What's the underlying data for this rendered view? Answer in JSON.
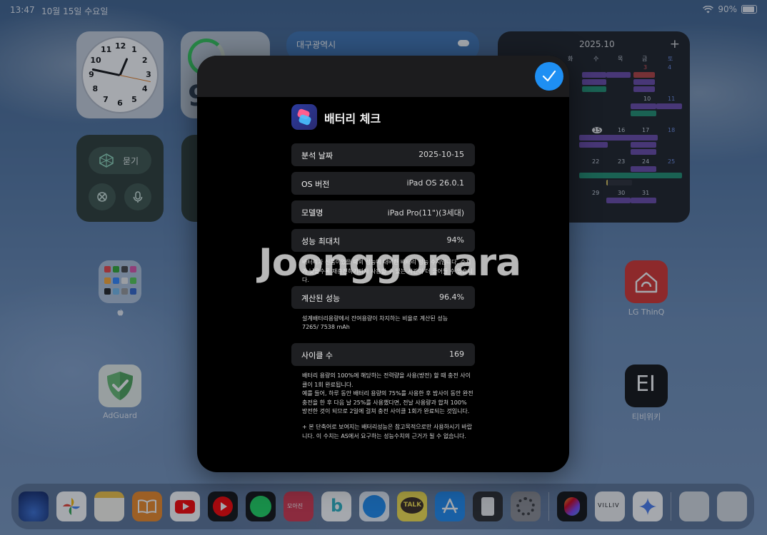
{
  "status_bar": {
    "time": "13:47",
    "date": "10월 15일 수요일",
    "battery_percent": "90%"
  },
  "widgets": {
    "clock_numbers": [
      "12",
      "1",
      "2",
      "3",
      "4",
      "5",
      "6",
      "7",
      "8",
      "9",
      "10",
      "11"
    ],
    "battery_value": "9",
    "weather_city": "대구광역시",
    "calendar": {
      "title": "2025.10",
      "weekday_headers": [
        "화",
        "수",
        "목",
        "금",
        "토"
      ],
      "dates": [
        "3",
        "4",
        "10",
        "11",
        "15",
        "16",
        "17",
        "18",
        "22",
        "23",
        "24",
        "25",
        "29",
        "30",
        "31"
      ]
    },
    "ask_label": "묻기"
  },
  "home_apps": [
    {
      "name": "LG ThinQ"
    },
    {
      "name": "AdGuard"
    },
    {
      "name": "티비위키"
    }
  ],
  "dock_icons": [
    "maps-icon",
    "photos-icon",
    "notes-icon",
    "books-icon",
    "youtube-icon",
    "youtube-music-icon",
    "spotify-icon",
    "moa-icon",
    "b-app-icon",
    "safari-icon",
    "kakaotalk-icon",
    "app-store-icon",
    "calculator-icon",
    "settings-icon",
    "procreate-icon",
    "villiv-icon",
    "gemini-icon",
    "recent-app-1-icon",
    "recent-app-2-icon"
  ],
  "dock_labels": {
    "kakaotalk": "TALK",
    "villiv": "VILLIV",
    "moa": "모아진"
  },
  "shortcut": {
    "title": "배터리 체크",
    "rows": [
      {
        "key": "분석 날짜",
        "value": "2025-10-15"
      },
      {
        "key": "OS 버전",
        "value": "iPad OS 26.0.1"
      },
      {
        "key": "모델명",
        "value": "iPad Pro(11\")(3세대)"
      },
      {
        "key": "성능 최대치",
        "value": "94%"
      },
      {
        "key": "계산된 성능",
        "value": "96.4%"
      },
      {
        "key": "사이클 수",
        "value": "169"
      }
    ],
    "note_max": "배터리가 신품이었을 때의 성능에 대비한 배터리 성능 수치입니다. 수치가 낮을수록 재충전하기까지 사용할 수 있는 시간이 더 줄어들 수 있습니다.",
    "note_calc_1": "설계배터리용량에서 잔여용량이 차지하는 비율로 계산된 성능",
    "note_calc_2": "7265/ 7538 mAh",
    "note_cycle_1": "배터리 용량의 100%에 해당하는 전력량을 사용(방전) 할 때 충전 사이클이 1회 완료됩니다.",
    "note_cycle_2": "예를 들어, 하루 동안 배터리 용량의 75%를 사용한 후 밤사이 동안 완전충전을 한 후 다음 날 25%를 사용했다면, 전날 사용량과 합쳐 100% 방전한 것이 되므로 2일에 걸쳐 충전 사이클 1회가 완료되는 것입니다.",
    "note_disclaimer": "+ 본 단축어로 보여지는 배터리성능은 참고목적으로만 사용하시기 바랍니다. 이 수치는 AS에서 요구하는 성능수치의 근거가 될 수 없습니다."
  },
  "watermark": "Joonggonara"
}
